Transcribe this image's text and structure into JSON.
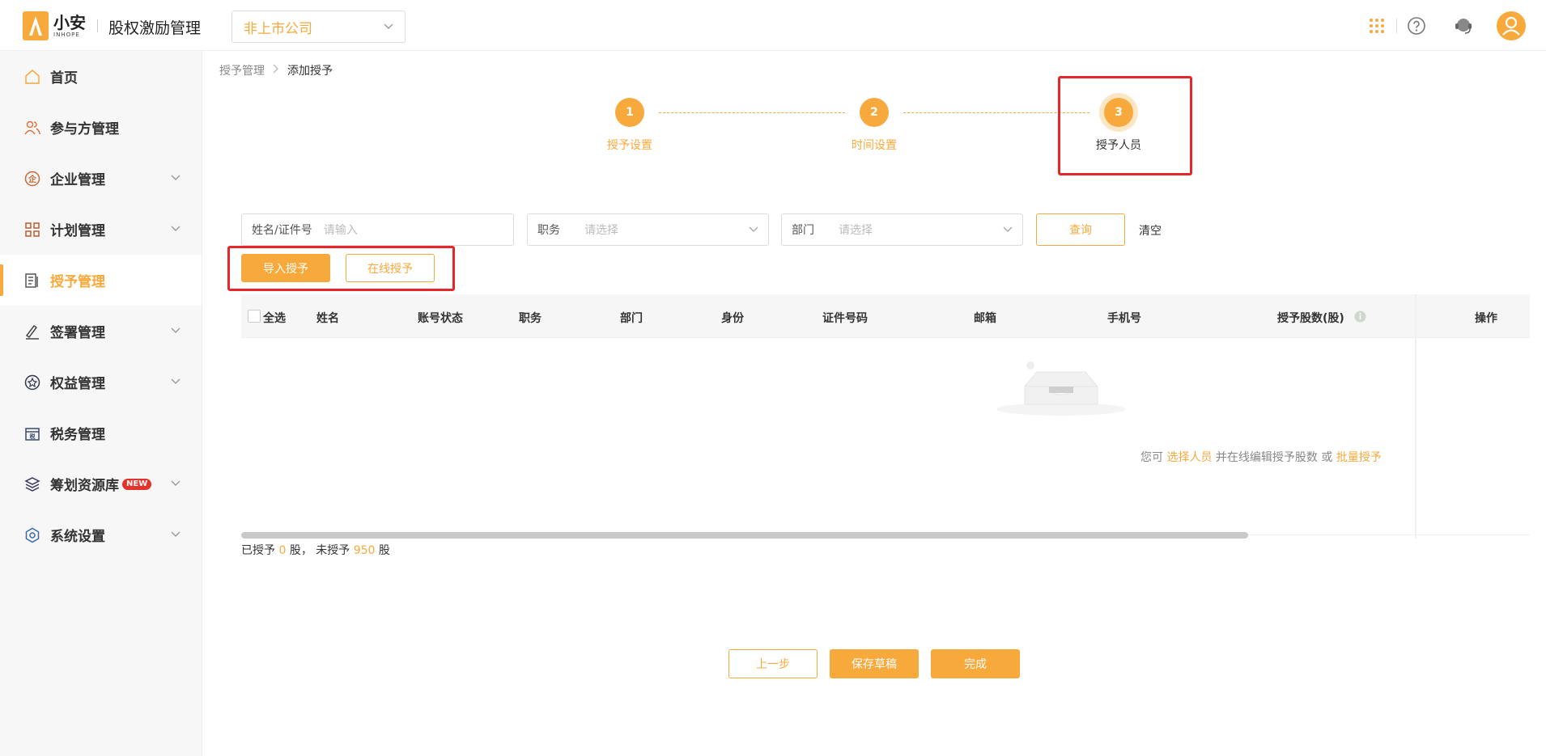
{
  "header": {
    "logo_cn": "小安",
    "logo_en": "INHOPE",
    "app_title": "股权激励管理",
    "company_select": "非上市公司"
  },
  "sidebar": {
    "items": [
      {
        "label": "首页"
      },
      {
        "label": "参与方管理"
      },
      {
        "label": "企业管理"
      },
      {
        "label": "计划管理"
      },
      {
        "label": "授予管理"
      },
      {
        "label": "签署管理"
      },
      {
        "label": "权益管理"
      },
      {
        "label": "税务管理"
      },
      {
        "label": "筹划资源库",
        "badge": "NEW"
      },
      {
        "label": "系统设置"
      }
    ],
    "active_index": 4
  },
  "breadcrumb": {
    "parent": "授予管理",
    "current": "添加授予"
  },
  "steps": [
    {
      "num": "1",
      "label": "授予设置"
    },
    {
      "num": "2",
      "label": "时间设置"
    },
    {
      "num": "3",
      "label": "授予人员"
    }
  ],
  "filters": {
    "name_label": "姓名/证件号",
    "name_placeholder": "请输入",
    "position_label": "职务",
    "position_placeholder": "请选择",
    "dept_label": "部门",
    "dept_placeholder": "请选择",
    "query_button": "查询",
    "clear_link": "清空"
  },
  "actions": {
    "import_button": "导入授予",
    "online_button": "在线授予"
  },
  "table": {
    "select_all": "全选",
    "columns": [
      "姓名",
      "账号状态",
      "职务",
      "部门",
      "身份",
      "证件号码",
      "邮箱",
      "手机号",
      "授予股数(股)",
      "操作"
    ],
    "empty_prefix": "您可",
    "empty_link1": "选择人员",
    "empty_middle": "并在线编辑授予股数 或",
    "empty_link2": "批量授予"
  },
  "summary": {
    "granted_prefix": "已授予",
    "granted_value": "0",
    "granted_unit": "股，",
    "ungranted_prefix": "未授予",
    "ungranted_value": "950",
    "ungranted_unit": "股"
  },
  "footer": {
    "prev_button": "上一步",
    "draft_button": "保存草稿",
    "finish_button": "完成"
  },
  "colors": {
    "accent": "#f7a93b",
    "highlight": "#e5262b"
  }
}
